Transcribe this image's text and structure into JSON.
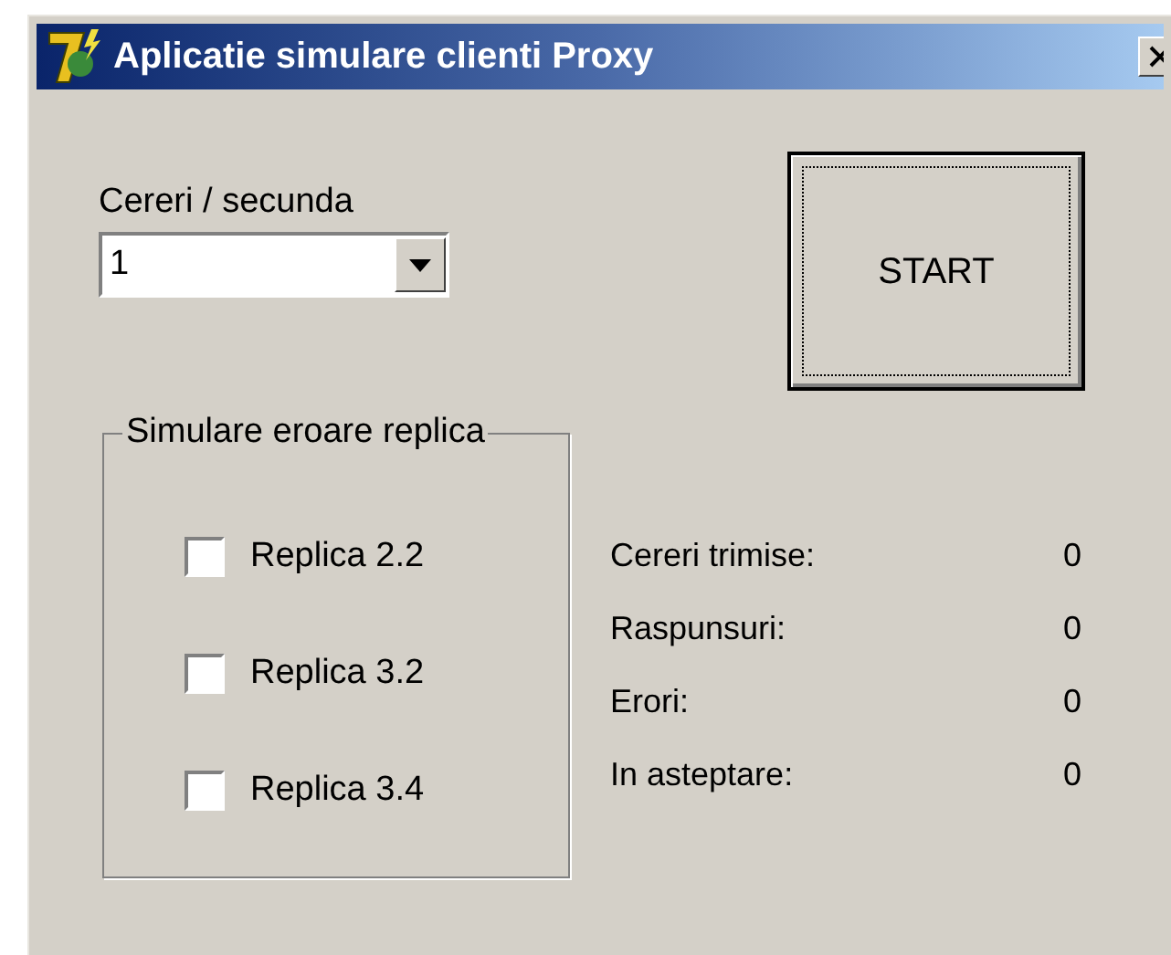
{
  "window": {
    "title": "Aplicatie simulare clienti Proxy"
  },
  "rate": {
    "label": "Cereri / secunda",
    "value": "1"
  },
  "start_button": {
    "label": "START",
    "focused": true
  },
  "error_group": {
    "title": "Simulare eroare replica",
    "replicas": [
      {
        "label": "Replica 2.2",
        "checked": false
      },
      {
        "label": "Replica 3.2",
        "checked": false
      },
      {
        "label": "Replica 3.4",
        "checked": false
      }
    ]
  },
  "stats": [
    {
      "label": "Cereri trimise:",
      "value": "0"
    },
    {
      "label": "Raspunsuri:",
      "value": "0"
    },
    {
      "label": "Erori:",
      "value": "0"
    },
    {
      "label": "In asteptare:",
      "value": "0"
    }
  ]
}
